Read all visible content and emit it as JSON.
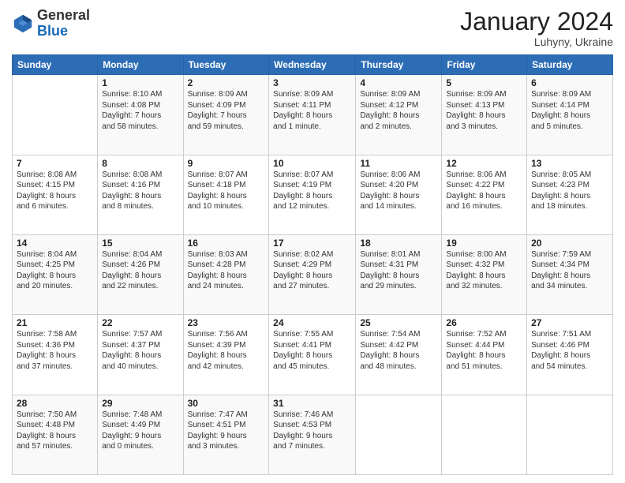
{
  "header": {
    "logo_general": "General",
    "logo_blue": "Blue",
    "month": "January 2024",
    "location": "Luhyny, Ukraine"
  },
  "weekdays": [
    "Sunday",
    "Monday",
    "Tuesday",
    "Wednesday",
    "Thursday",
    "Friday",
    "Saturday"
  ],
  "weeks": [
    [
      {
        "day": "",
        "info": ""
      },
      {
        "day": "1",
        "info": "Sunrise: 8:10 AM\nSunset: 4:08 PM\nDaylight: 7 hours\nand 58 minutes."
      },
      {
        "day": "2",
        "info": "Sunrise: 8:09 AM\nSunset: 4:09 PM\nDaylight: 7 hours\nand 59 minutes."
      },
      {
        "day": "3",
        "info": "Sunrise: 8:09 AM\nSunset: 4:11 PM\nDaylight: 8 hours\nand 1 minute."
      },
      {
        "day": "4",
        "info": "Sunrise: 8:09 AM\nSunset: 4:12 PM\nDaylight: 8 hours\nand 2 minutes."
      },
      {
        "day": "5",
        "info": "Sunrise: 8:09 AM\nSunset: 4:13 PM\nDaylight: 8 hours\nand 3 minutes."
      },
      {
        "day": "6",
        "info": "Sunrise: 8:09 AM\nSunset: 4:14 PM\nDaylight: 8 hours\nand 5 minutes."
      }
    ],
    [
      {
        "day": "7",
        "info": "Sunrise: 8:08 AM\nSunset: 4:15 PM\nDaylight: 8 hours\nand 6 minutes."
      },
      {
        "day": "8",
        "info": "Sunrise: 8:08 AM\nSunset: 4:16 PM\nDaylight: 8 hours\nand 8 minutes."
      },
      {
        "day": "9",
        "info": "Sunrise: 8:07 AM\nSunset: 4:18 PM\nDaylight: 8 hours\nand 10 minutes."
      },
      {
        "day": "10",
        "info": "Sunrise: 8:07 AM\nSunset: 4:19 PM\nDaylight: 8 hours\nand 12 minutes."
      },
      {
        "day": "11",
        "info": "Sunrise: 8:06 AM\nSunset: 4:20 PM\nDaylight: 8 hours\nand 14 minutes."
      },
      {
        "day": "12",
        "info": "Sunrise: 8:06 AM\nSunset: 4:22 PM\nDaylight: 8 hours\nand 16 minutes."
      },
      {
        "day": "13",
        "info": "Sunrise: 8:05 AM\nSunset: 4:23 PM\nDaylight: 8 hours\nand 18 minutes."
      }
    ],
    [
      {
        "day": "14",
        "info": "Sunrise: 8:04 AM\nSunset: 4:25 PM\nDaylight: 8 hours\nand 20 minutes."
      },
      {
        "day": "15",
        "info": "Sunrise: 8:04 AM\nSunset: 4:26 PM\nDaylight: 8 hours\nand 22 minutes."
      },
      {
        "day": "16",
        "info": "Sunrise: 8:03 AM\nSunset: 4:28 PM\nDaylight: 8 hours\nand 24 minutes."
      },
      {
        "day": "17",
        "info": "Sunrise: 8:02 AM\nSunset: 4:29 PM\nDaylight: 8 hours\nand 27 minutes."
      },
      {
        "day": "18",
        "info": "Sunrise: 8:01 AM\nSunset: 4:31 PM\nDaylight: 8 hours\nand 29 minutes."
      },
      {
        "day": "19",
        "info": "Sunrise: 8:00 AM\nSunset: 4:32 PM\nDaylight: 8 hours\nand 32 minutes."
      },
      {
        "day": "20",
        "info": "Sunrise: 7:59 AM\nSunset: 4:34 PM\nDaylight: 8 hours\nand 34 minutes."
      }
    ],
    [
      {
        "day": "21",
        "info": "Sunrise: 7:58 AM\nSunset: 4:36 PM\nDaylight: 8 hours\nand 37 minutes."
      },
      {
        "day": "22",
        "info": "Sunrise: 7:57 AM\nSunset: 4:37 PM\nDaylight: 8 hours\nand 40 minutes."
      },
      {
        "day": "23",
        "info": "Sunrise: 7:56 AM\nSunset: 4:39 PM\nDaylight: 8 hours\nand 42 minutes."
      },
      {
        "day": "24",
        "info": "Sunrise: 7:55 AM\nSunset: 4:41 PM\nDaylight: 8 hours\nand 45 minutes."
      },
      {
        "day": "25",
        "info": "Sunrise: 7:54 AM\nSunset: 4:42 PM\nDaylight: 8 hours\nand 48 minutes."
      },
      {
        "day": "26",
        "info": "Sunrise: 7:52 AM\nSunset: 4:44 PM\nDaylight: 8 hours\nand 51 minutes."
      },
      {
        "day": "27",
        "info": "Sunrise: 7:51 AM\nSunset: 4:46 PM\nDaylight: 8 hours\nand 54 minutes."
      }
    ],
    [
      {
        "day": "28",
        "info": "Sunrise: 7:50 AM\nSunset: 4:48 PM\nDaylight: 8 hours\nand 57 minutes."
      },
      {
        "day": "29",
        "info": "Sunrise: 7:48 AM\nSunset: 4:49 PM\nDaylight: 9 hours\nand 0 minutes."
      },
      {
        "day": "30",
        "info": "Sunrise: 7:47 AM\nSunset: 4:51 PM\nDaylight: 9 hours\nand 3 minutes."
      },
      {
        "day": "31",
        "info": "Sunrise: 7:46 AM\nSunset: 4:53 PM\nDaylight: 9 hours\nand 7 minutes."
      },
      {
        "day": "",
        "info": ""
      },
      {
        "day": "",
        "info": ""
      },
      {
        "day": "",
        "info": ""
      }
    ]
  ]
}
